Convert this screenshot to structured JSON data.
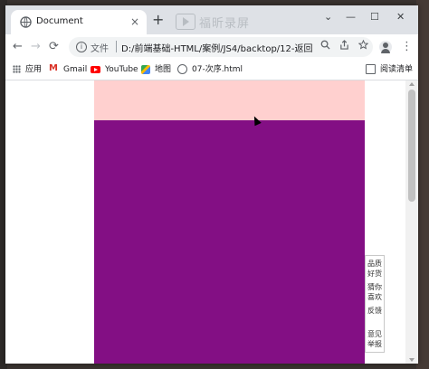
{
  "tab": {
    "title": "Document",
    "close": "×",
    "new_tab": "+"
  },
  "watermark": {
    "text": "福昕录屏"
  },
  "window_controls": {
    "menu": "⌄",
    "minimize": "—",
    "maximize": "☐",
    "close": "✕"
  },
  "toolbar": {
    "back": "←",
    "forward": "→",
    "reload": "⟳",
    "scheme_label": "文件",
    "url": "D:/前端基础-HTML/案例/JS4/backtop/12-返回顶部.ht...",
    "menu": "⋮"
  },
  "bookmarks": [
    {
      "label": "应用",
      "icon": "apps-icon"
    },
    {
      "label": "Gmail",
      "icon": "gmail-icon"
    },
    {
      "label": "YouTube",
      "icon": "youtube-icon"
    },
    {
      "label": "地图",
      "icon": "maps-icon"
    },
    {
      "label": "07-次序.html",
      "icon": "globe-icon"
    }
  ],
  "reading_list": {
    "label": "阅读清单",
    "icon": "reading-list-icon"
  },
  "page": {
    "colors": {
      "top_box": "#ffd0cf",
      "main_box": "#830f84"
    },
    "sidenav": [
      "品质好货",
      "猜你喜欢",
      "反馈",
      "",
      "意见举报"
    ]
  }
}
